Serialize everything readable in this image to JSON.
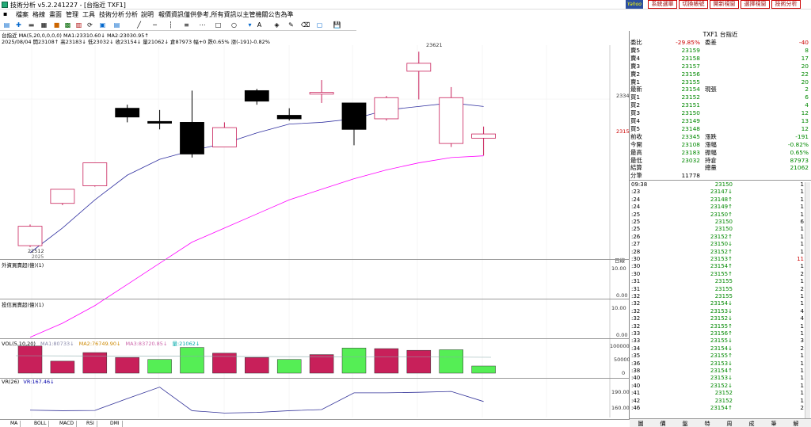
{
  "window": {
    "title": "技術分析 v5.2.241227 - [台指近 TXF1]",
    "min": "—",
    "max": "□",
    "close": "✕"
  },
  "menu": {
    "items": [
      "檔案",
      "格線",
      "畫面",
      "管理",
      "工具",
      "技術分析",
      "分析",
      "說明"
    ],
    "marquee": "報價資訊僅供參考,所有資訊以主管機關公告為準"
  },
  "topbuttons": {
    "logo": "Yahoo",
    "items": [
      "系統選單",
      "切換帳號",
      "開新視窗",
      "選擇視窗",
      "技術分析"
    ]
  },
  "chart": {
    "info_line1": "台指近 MA(5,20,0,0,0,0) MA1:23310.60↓ MA2:23030.95↑",
    "info_line2": "2025/08/04 開23108↑ 高23183↓ 低23032↓ 收23154↓ 量21062↓ 倉87973 幅+0 跌0.65% 漲(-191)-0.82%",
    "price_labels": {
      "high": "23621",
      "low": "22512",
      "last": "23154",
      "ref": "23345"
    },
    "date_label": "日線",
    "pane2_title": "外資買賣超(億)(1)",
    "pane2_ticks": [
      "10.00",
      "0.00"
    ],
    "pane3_title": "投信買賣超(億)(1)",
    "pane3_ticks": [
      "10.00",
      "0.00"
    ],
    "vol_title": "VOL(5,10,20)",
    "vol_ma1": "MA1:80733↓",
    "vol_ma2": "MA2:76749.90↓",
    "vol_ma3": "MA3:83720.85↓",
    "vol_cur": "量:21062↓",
    "vol_ticks": [
      "100000",
      "50000",
      "0"
    ],
    "vr_title": "VR(26)",
    "vr_val": "VR:167.46↓",
    "vr_ticks": [
      "190.00",
      "160.00"
    ],
    "bottom_label": "2025"
  },
  "chart_data": {
    "type": "candlestick",
    "candles": [
      {
        "o": 22520,
        "h": 22640,
        "l": 22512,
        "c": 22630
      },
      {
        "o": 22760,
        "h": 22830,
        "l": 22750,
        "c": 22840
      },
      {
        "o": 22860,
        "h": 22890,
        "l": 22855,
        "c": 22990
      },
      {
        "o": 23300,
        "h": 23320,
        "l": 23220,
        "c": 23250
      },
      {
        "o": 23225,
        "h": 23290,
        "l": 23180,
        "c": 23215
      },
      {
        "o": 23220,
        "h": 23400,
        "l": 23020,
        "c": 23040
      },
      {
        "o": 23080,
        "h": 23220,
        "l": 23080,
        "c": 23190
      },
      {
        "o": 23400,
        "h": 23410,
        "l": 23320,
        "c": 23340
      },
      {
        "o": 23260,
        "h": 23300,
        "l": 23230,
        "c": 23240
      },
      {
        "o": 23380,
        "h": 23460,
        "l": 23330,
        "c": 23390
      },
      {
        "o": 23330,
        "h": 23330,
        "l": 23090,
        "c": 23180
      },
      {
        "o": 23240,
        "h": 23370,
        "l": 23230,
        "c": 23360
      },
      {
        "o": 23510,
        "h": 23621,
        "l": 23350,
        "c": 23555
      },
      {
        "o": 23100,
        "h": 23420,
        "l": 23080,
        "c": 23360
      },
      {
        "o": 23130,
        "h": 23196,
        "l": 23032,
        "c": 23154
      }
    ],
    "volume": [
      95000,
      42000,
      72000,
      55000,
      48000,
      90000,
      70000,
      55000,
      48000,
      65000,
      88000,
      86000,
      80000,
      82000,
      25000
    ],
    "volume_up": [
      true,
      true,
      true,
      true,
      false,
      false,
      true,
      true,
      false,
      true,
      false,
      true,
      true,
      false,
      false
    ],
    "vr": [
      120,
      118,
      119,
      160,
      200,
      118,
      110,
      112,
      118,
      122,
      180,
      180,
      182,
      185,
      150
    ],
    "ma1": [
      22480,
      22620,
      22780,
      22920,
      23010,
      23060,
      23100,
      23160,
      23210,
      23220,
      23240,
      23290,
      23310,
      23330,
      23310
    ],
    "ma2": [
      22000,
      22080,
      22180,
      22300,
      22420,
      22540,
      22620,
      22700,
      22780,
      22840,
      22900,
      22950,
      22990,
      23020,
      23030
    ]
  },
  "quote": {
    "header": "TXF1 台指近",
    "rows": [
      {
        "l": "委比",
        "v": "-29.85%",
        "l2": "委差",
        "v2": "-40",
        "c": "red"
      },
      {
        "l": "賣5",
        "v": "23159",
        "l2": "",
        "v2": "8",
        "c": "green"
      },
      {
        "l": "賣4",
        "v": "23158",
        "l2": "",
        "v2": "17",
        "c": "green"
      },
      {
        "l": "賣3",
        "v": "23157",
        "l2": "",
        "v2": "20",
        "c": "green"
      },
      {
        "l": "賣2",
        "v": "23156",
        "l2": "",
        "v2": "22",
        "c": "green"
      },
      {
        "l": "賣1",
        "v": "23155",
        "l2": "",
        "v2": "20",
        "c": "green"
      },
      {
        "l": "最新",
        "v": "23154",
        "l2": "現張",
        "v2": "2",
        "c": "green"
      },
      {
        "l": "買1",
        "v": "23152",
        "l2": "",
        "v2": "6",
        "c": "green"
      },
      {
        "l": "買2",
        "v": "23151",
        "l2": "",
        "v2": "4",
        "c": "green"
      },
      {
        "l": "買3",
        "v": "23150",
        "l2": "",
        "v2": "12",
        "c": "green"
      },
      {
        "l": "買4",
        "v": "23149",
        "l2": "",
        "v2": "13",
        "c": "green"
      },
      {
        "l": "買5",
        "v": "23148",
        "l2": "",
        "v2": "12",
        "c": "green"
      },
      {
        "l": "前收",
        "v": "23345",
        "l2": "漲跌",
        "v2": "-191",
        "c": "green"
      },
      {
        "l": "今開",
        "v": "23108",
        "l2": "漲幅",
        "v2": "-0.82%",
        "c": "green"
      },
      {
        "l": "最高",
        "v": "23183",
        "l2": "振幅",
        "v2": "0.65%",
        "c": "green"
      },
      {
        "l": "最低",
        "v": "23032",
        "l2": "持倉",
        "v2": "87973",
        "c": "green"
      },
      {
        "l": "結算",
        "v": "",
        "l2": "總量",
        "v2": "21062",
        "c": "green"
      },
      {
        "l": "分筆",
        "v": "11778",
        "l2": "",
        "v2": "",
        "c": "black"
      }
    ]
  },
  "ticks": [
    {
      "t": "09:38",
      "p": "23150",
      "v": "1"
    },
    {
      "t": ":23",
      "p": "23147↓",
      "v": "1"
    },
    {
      "t": ":24",
      "p": "23148↑",
      "v": "1"
    },
    {
      "t": ":24",
      "p": "23149↑",
      "v": "1"
    },
    {
      "t": ":25",
      "p": "23150↑",
      "v": "1"
    },
    {
      "t": ":25",
      "p": "23150",
      "v": "6"
    },
    {
      "t": ":25",
      "p": "23150",
      "v": "1"
    },
    {
      "t": ":26",
      "p": "23152↑",
      "v": "1"
    },
    {
      "t": ":27",
      "p": "23150↓",
      "v": "1"
    },
    {
      "t": ":28",
      "p": "23152↑",
      "v": "1"
    },
    {
      "t": ":30",
      "p": "23153↑",
      "v": "11"
    },
    {
      "t": ":30",
      "p": "23154↑",
      "v": "1"
    },
    {
      "t": ":30",
      "p": "23155↑",
      "v": "2"
    },
    {
      "t": ":31",
      "p": "23155",
      "v": "1"
    },
    {
      "t": ":31",
      "p": "23155",
      "v": "2"
    },
    {
      "t": ":32",
      "p": "23155",
      "v": "1"
    },
    {
      "t": ":32",
      "p": "23154↓",
      "v": "1"
    },
    {
      "t": ":32",
      "p": "23153↓",
      "v": "4"
    },
    {
      "t": ":32",
      "p": "23152↓",
      "v": "4"
    },
    {
      "t": ":32",
      "p": "23155↑",
      "v": "1"
    },
    {
      "t": ":33",
      "p": "23156↑",
      "v": "1"
    },
    {
      "t": ":33",
      "p": "23155↓",
      "v": "3"
    },
    {
      "t": ":34",
      "p": "23154↓",
      "v": "2"
    },
    {
      "t": ":35",
      "p": "23155↑",
      "v": "1"
    },
    {
      "t": ":36",
      "p": "23153↓",
      "v": "1"
    },
    {
      "t": ":38",
      "p": "23154↑",
      "v": "1"
    },
    {
      "t": ":40",
      "p": "23153↓",
      "v": "1"
    },
    {
      "t": ":40",
      "p": "23152↓",
      "v": "1"
    },
    {
      "t": ":41",
      "p": "23152",
      "v": "1"
    },
    {
      "t": ":42",
      "p": "23152",
      "v": "1"
    },
    {
      "t": ":46",
      "p": "23154↑",
      "v": "2"
    }
  ],
  "bottom_tabs": [
    "MA",
    "BOLL",
    "MACD",
    "RSI",
    "DMI"
  ],
  "right_tabs": [
    "圖",
    "價",
    "盤",
    "特",
    "周",
    "成",
    "筆",
    "解"
  ],
  "colors": {
    "up": "#c8205a",
    "down": "#000000",
    "ma1": "#3030a0",
    "ma2": "#ff00ff",
    "green": "#55ee55",
    "red": "#cc0000"
  }
}
